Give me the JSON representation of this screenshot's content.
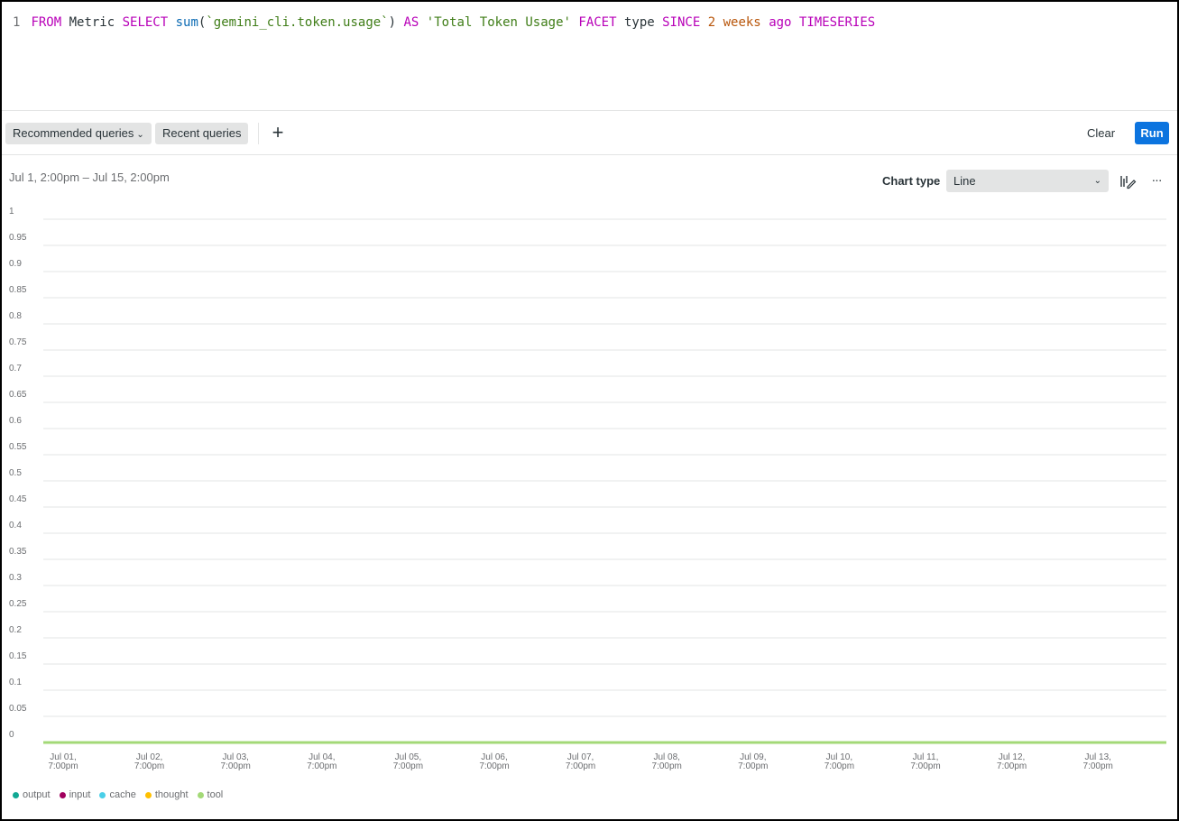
{
  "editor": {
    "line_number": "1",
    "tokens": [
      {
        "text": "FROM",
        "cls": "kw"
      },
      {
        "text": " Metric ",
        "cls": "plain"
      },
      {
        "text": "SELECT",
        "cls": "kw"
      },
      {
        "text": " ",
        "cls": "plain"
      },
      {
        "text": "sum",
        "cls": "fn"
      },
      {
        "text": "(",
        "cls": "plain"
      },
      {
        "text": "`gemini_cli.token.usage`",
        "cls": "str"
      },
      {
        "text": ") ",
        "cls": "plain"
      },
      {
        "text": "AS",
        "cls": "kw"
      },
      {
        "text": " ",
        "cls": "plain"
      },
      {
        "text": "'Total Token Usage'",
        "cls": "str"
      },
      {
        "text": " ",
        "cls": "plain"
      },
      {
        "text": "FACET",
        "cls": "kw"
      },
      {
        "text": " type ",
        "cls": "plain"
      },
      {
        "text": "SINCE",
        "cls": "kw"
      },
      {
        "text": " ",
        "cls": "plain"
      },
      {
        "text": "2",
        "cls": "num"
      },
      {
        "text": " ",
        "cls": "plain"
      },
      {
        "text": "weeks",
        "cls": "kw2"
      },
      {
        "text": " ",
        "cls": "plain"
      },
      {
        "text": "ago",
        "cls": "kw"
      },
      {
        "text": " ",
        "cls": "plain"
      },
      {
        "text": "TIMESERIES",
        "cls": "kw"
      }
    ]
  },
  "toolbar": {
    "recommended_label": "Recommended queries",
    "recent_label": "Recent queries",
    "add_icon": "plus-icon",
    "clear_label": "Clear",
    "run_label": "Run"
  },
  "chart_header": {
    "range": "Jul 1, 2:00pm – Jul 15, 2:00pm",
    "chart_type_label": "Chart type",
    "chart_type_value": "Line",
    "edit_icon": "chart-edit-icon",
    "more_icon": "more-icon"
  },
  "colors": {
    "run_button": "#0c74df",
    "output": "#11a893",
    "input": "#a1005e",
    "cache": "#4acfe8",
    "thought": "#ffc000",
    "tool": "#a3d977"
  },
  "chart_data": {
    "type": "line",
    "ylim": [
      0,
      1
    ],
    "yticks": [
      "1",
      "0.95",
      "0.9",
      "0.85",
      "0.8",
      "0.75",
      "0.7",
      "0.65",
      "0.6",
      "0.55",
      "0.5",
      "0.45",
      "0.4",
      "0.35",
      "0.3",
      "0.25",
      "0.2",
      "0.15",
      "0.1",
      "0.05",
      "0"
    ],
    "xticks": [
      [
        "Jul 01,",
        "7:00pm"
      ],
      [
        "Jul 02,",
        "7:00pm"
      ],
      [
        "Jul 03,",
        "7:00pm"
      ],
      [
        "Jul 04,",
        "7:00pm"
      ],
      [
        "Jul 05,",
        "7:00pm"
      ],
      [
        "Jul 06,",
        "7:00pm"
      ],
      [
        "Jul 07,",
        "7:00pm"
      ],
      [
        "Jul 08,",
        "7:00pm"
      ],
      [
        "Jul 09,",
        "7:00pm"
      ],
      [
        "Jul 10,",
        "7:00pm"
      ],
      [
        "Jul 11,",
        "7:00pm"
      ],
      [
        "Jul 12,",
        "7:00pm"
      ],
      [
        "Jul 13,",
        "7:00pm"
      ]
    ],
    "series": [
      {
        "name": "output",
        "values": [
          0,
          0
        ]
      },
      {
        "name": "input",
        "values": [
          0,
          0
        ]
      },
      {
        "name": "cache",
        "values": [
          0,
          0
        ]
      },
      {
        "name": "thought",
        "values": [
          0,
          0
        ]
      },
      {
        "name": "tool",
        "values": [
          0,
          0
        ]
      }
    ]
  }
}
